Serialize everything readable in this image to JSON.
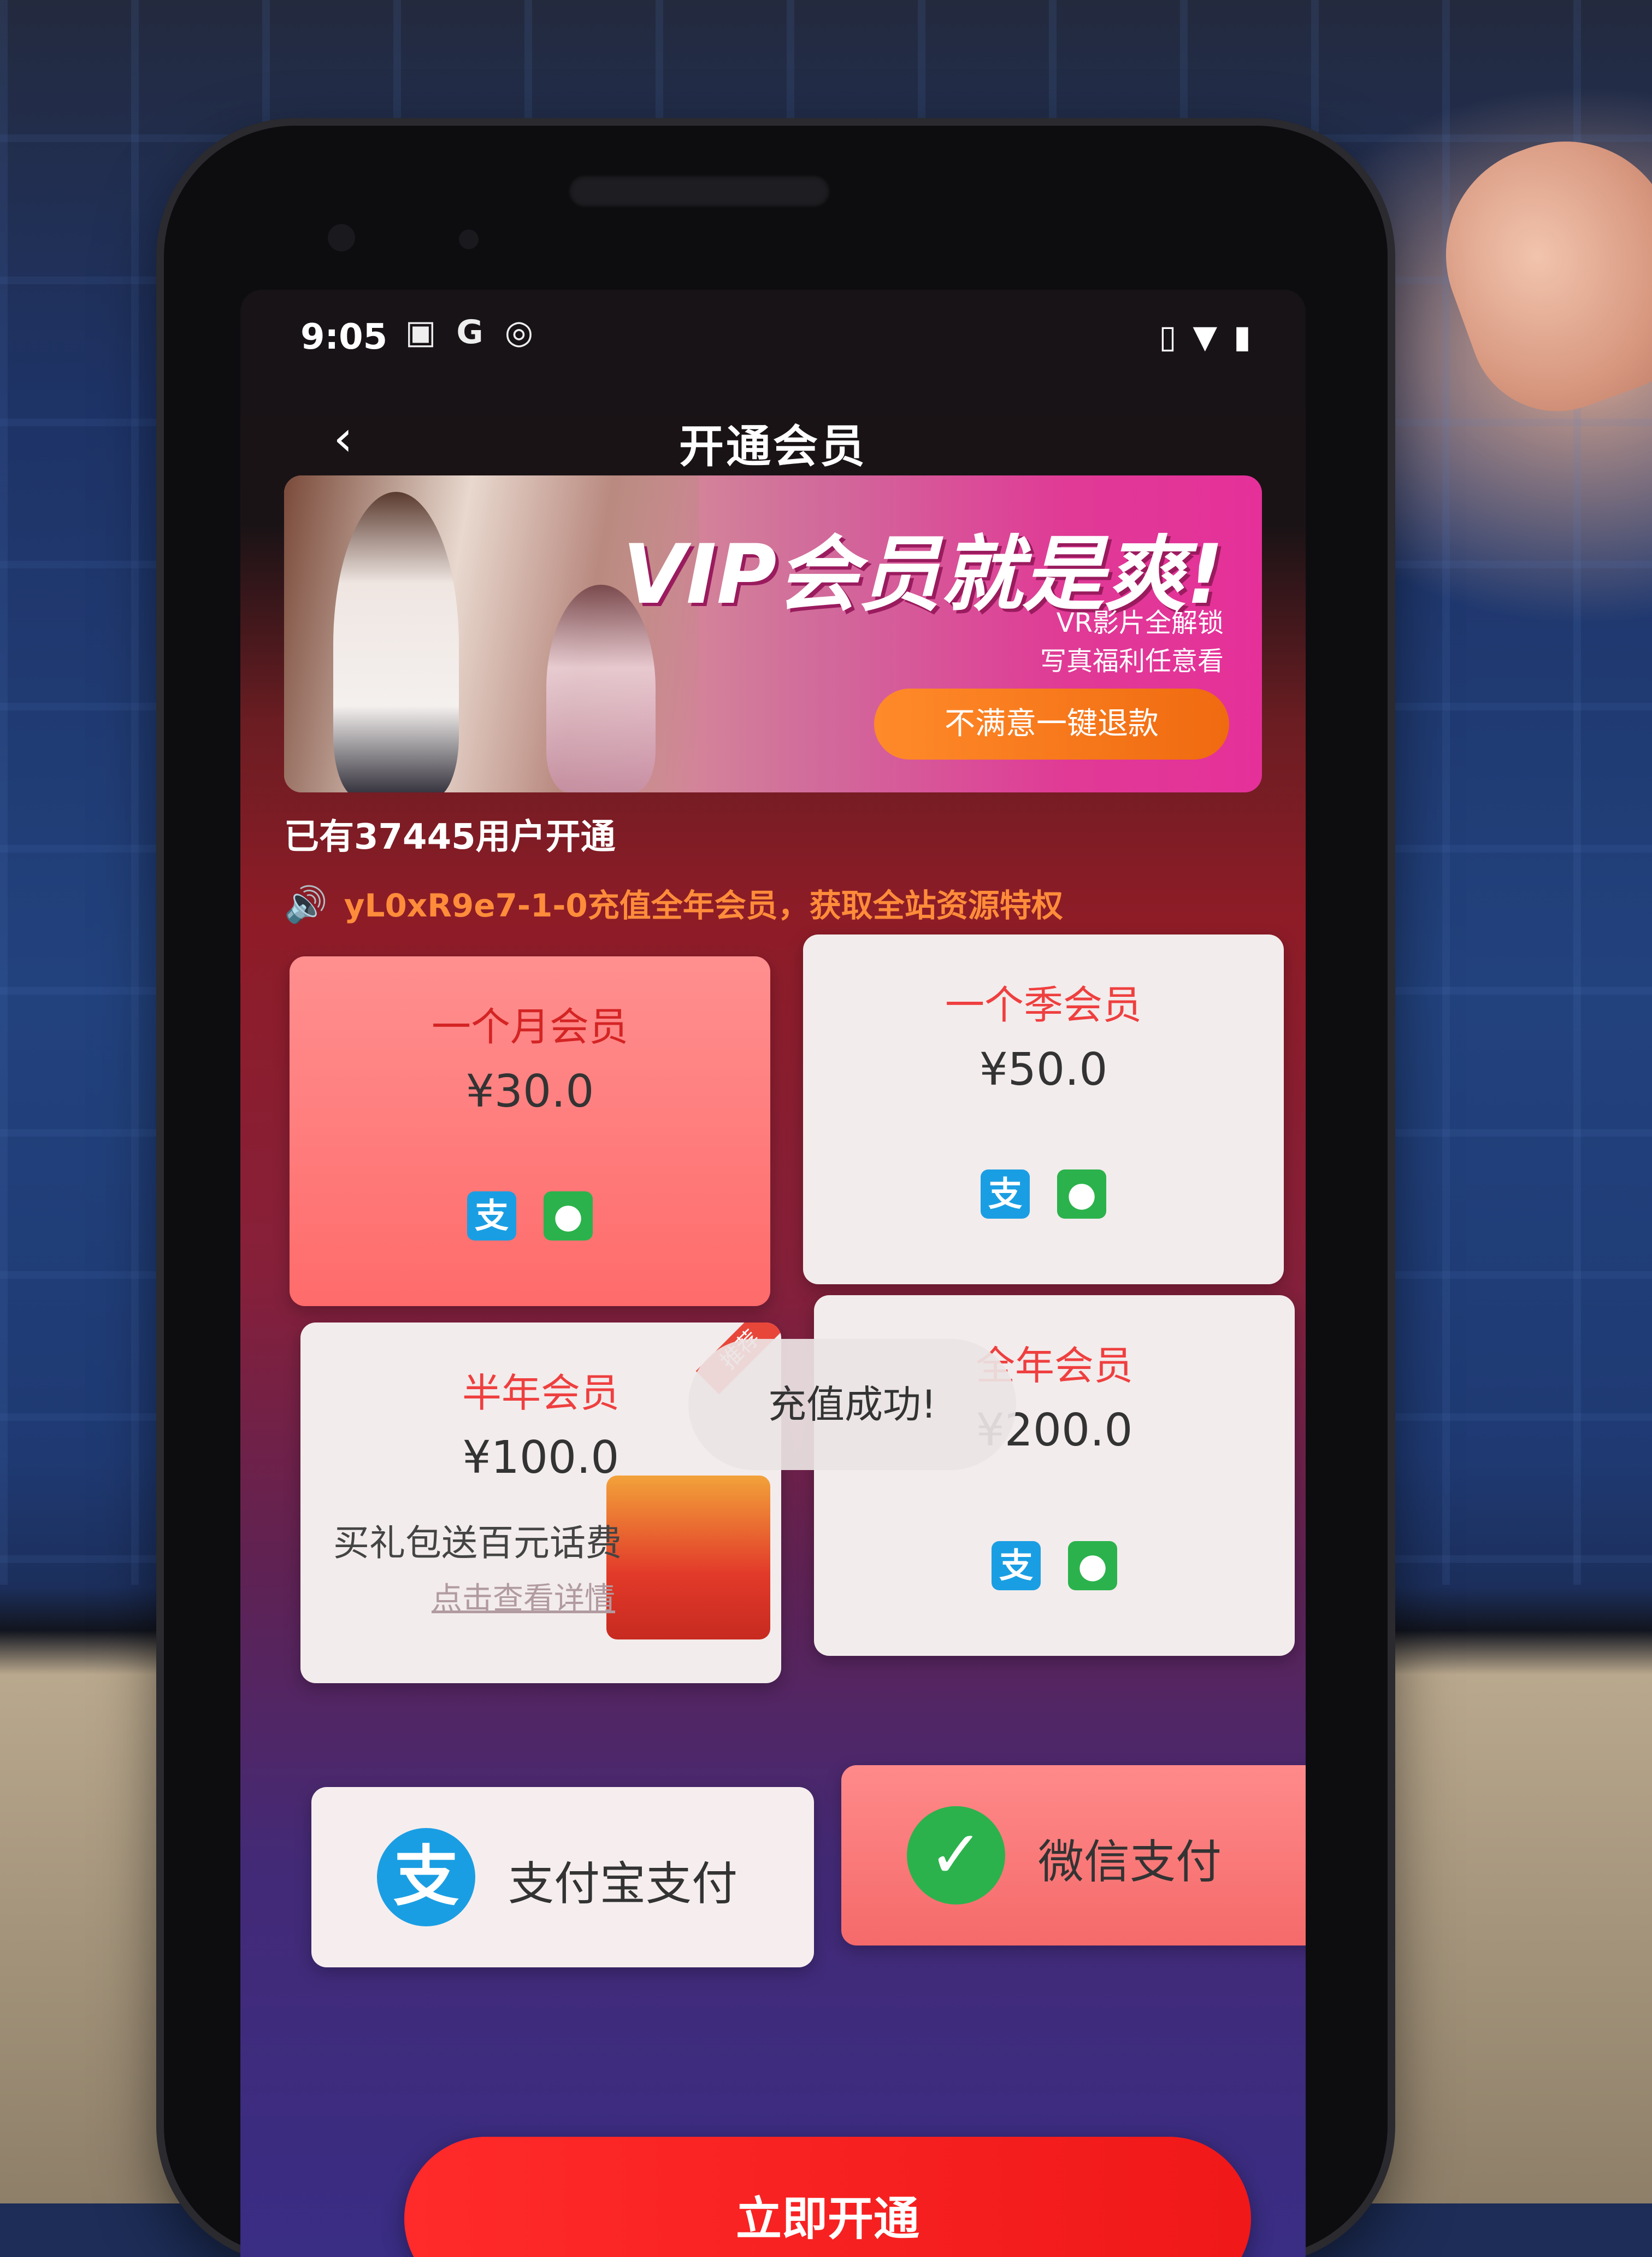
{
  "status_bar": {
    "time": "9:05",
    "icons": [
      "image-notification-icon",
      "google-icon",
      "vpn-icon"
    ],
    "right_icons": [
      "vibrate-icon",
      "wifi-icon",
      "battery-icon"
    ]
  },
  "nav": {
    "back_icon": "chevron-left-icon",
    "title": "开通会员"
  },
  "banner": {
    "title": "VIP会员就是爽!",
    "line1": "VR影片全解锁",
    "line2": "写真福利任意看",
    "button": "不满意一键退款"
  },
  "stats": {
    "users_line": "已有37445用户开通"
  },
  "notice": {
    "icon": "speaker-icon",
    "text": "yL0xR9e7-1-0充值全年会员，获取全站资源特权",
    "color": "#ff8c3a"
  },
  "plans": [
    {
      "name": "一个月会员",
      "price": "¥30.0",
      "selected": true
    },
    {
      "name": "一个季会员",
      "price": "¥50.0",
      "selected": false
    },
    {
      "name": "半年会员",
      "price": "¥100.0",
      "extra": "买礼包送百元话费",
      "link": "点击查看详情",
      "badge": "推荐",
      "selected": false
    },
    {
      "name": "全年会员",
      "price": "¥200.0",
      "selected": false
    }
  ],
  "toast": {
    "text": "充值成功!"
  },
  "payment": {
    "alipay_label": "支付宝支付",
    "wechat_label": "微信支付",
    "selected": "wechat"
  },
  "cta": {
    "label": "立即开通",
    "color": "#ff2a2a"
  },
  "colors": {
    "accent": "#ef3f3f",
    "alipay": "#1a9ee3",
    "wechat": "#2bb24c"
  }
}
